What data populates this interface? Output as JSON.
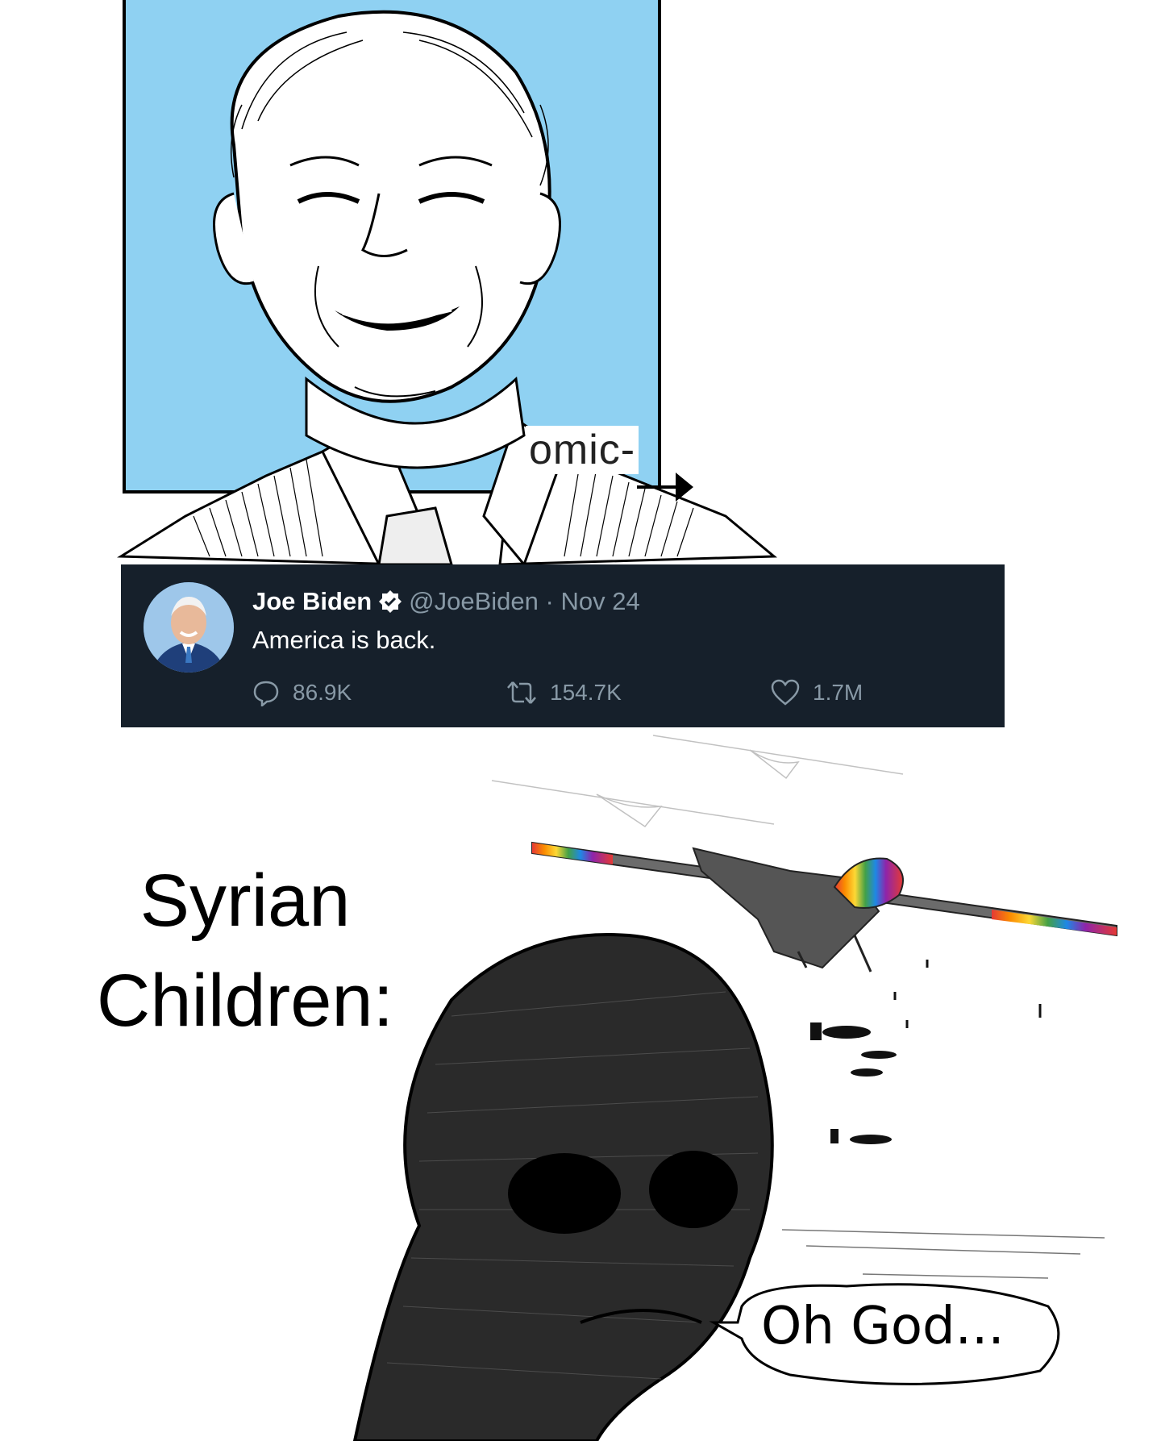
{
  "top_panel": {
    "comic_label": "omic-"
  },
  "tweet": {
    "name": "Joe Biden",
    "handle": "@JoeBiden",
    "separator": "·",
    "date": "Nov 24",
    "text": "America is back.",
    "replies": "86.9K",
    "retweets": "154.7K",
    "likes": "1.7M",
    "bg_color": "#16202b",
    "verified_color": "#ffffff"
  },
  "bottom_panel": {
    "caption": "Syrian Children:",
    "speech": "Oh God..."
  },
  "colors": {
    "sky": "#8fd1f2",
    "tweet_bg": "#16202b",
    "muted_text": "#8899a6"
  }
}
